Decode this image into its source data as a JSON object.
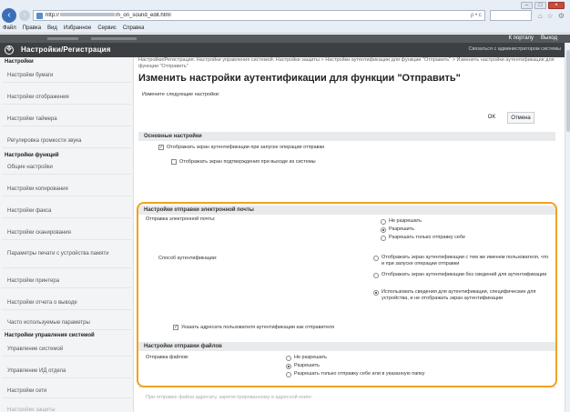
{
  "browser": {
    "url_prefix": "http://",
    "url_suffix": "m_on_sound_edit.html",
    "address_tools": "← → ×",
    "search_tools": "ρ • с",
    "menu": [
      "Файл",
      "Правка",
      "Вид",
      "Избранное",
      "Сервис",
      "Справка"
    ]
  },
  "app": {
    "title": "Настройки/Регистрация",
    "top_links": [
      "К порталу",
      "Выход"
    ],
    "admin_label": "Связаться с администратором системы"
  },
  "sidebar": {
    "group1": "Настройки",
    "group1_items": [
      "Настройки бумаги",
      "Настройки отображения",
      "Настройки таймера",
      "Регулировка громкости звука"
    ],
    "group2": "Настройки функций",
    "group2_items": [
      "Общие настройки",
      "Настройки копирования",
      "Настройки факса",
      "Настройки сканирования",
      "Параметры печати с устройства памяти",
      "Настройки принтера",
      "Настройки отчета о выводе",
      "Часто используемые параметры"
    ],
    "group3": "Настройки управления системой",
    "group3_items": [
      "Управление системой",
      "Управление ИД отдела",
      "Настройки сети",
      "Настройки защиты"
    ]
  },
  "main": {
    "breadcrumb": "Настройки/Регистрация: Настройки управления системой: Настройки защиты > Настройки аутентификации для функции \"Отправить\" > Изменить настройки аутентификации для функции \"Отправить\"",
    "title": "Изменить настройки аутентификации для функции \"Отправить\"",
    "instruction": "Измените следующие настройки:",
    "ok_label": "OK",
    "cancel_label": "Отмена",
    "basic": {
      "header": "Основные настройки",
      "show_auth_on_start": "Отображать экран аутентификации при запуске операции отправки",
      "show_confirm_on_logout": "Отображать экран подтверждения при выходе из системы"
    },
    "email": {
      "header": "Настройки отправки электронной почты",
      "send_label": "Отправка электронной почты:",
      "send_options": [
        "Не разрешать",
        "Разрешить",
        "Разрешать только отправку себе"
      ],
      "auth_label": "Способ аутентификации:",
      "auth_options": [
        "Отображать экран аутентификации с тем же именем пользователя, что и при запуске операции отправки",
        "Отображать экран аутентификации без сведений для аутентификации",
        "Использовать сведения для аутентификации, специфические для устройства, и не отображать экран аутентификации"
      ],
      "sender_address": "Указать адресата пользователя аутентификации как отправителя"
    },
    "file": {
      "header": "Настройки отправки файлов",
      "send_label": "Отправка файлов:",
      "send_options": [
        "Не разрешать",
        "Разрешить",
        "Разрешать только отправку себе или в указанную папку"
      ],
      "bottom_note": "При отправке файла адресату, зарегистрированному в адресной книге:"
    }
  }
}
